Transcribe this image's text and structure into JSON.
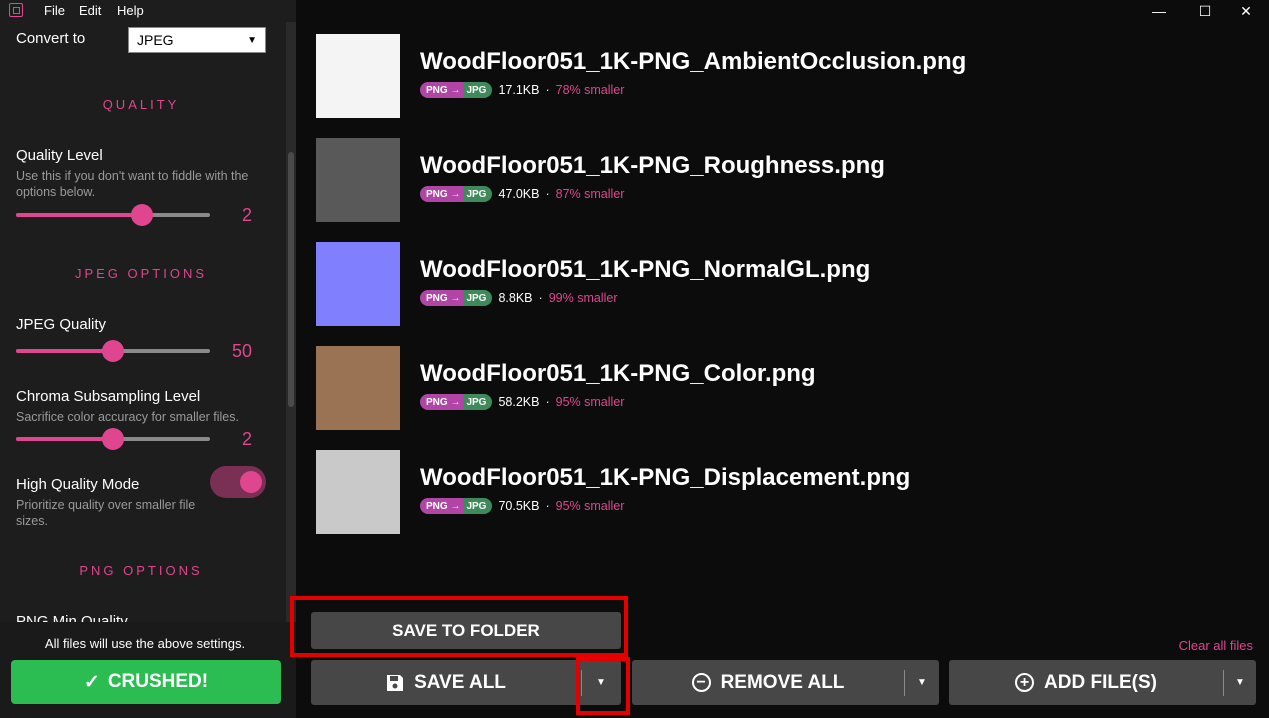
{
  "menu": {
    "file": "File",
    "edit": "Edit",
    "help": "Help"
  },
  "window_controls": {
    "minimize": "—",
    "maximize": "☐",
    "close": "✕"
  },
  "sidebar": {
    "convert_to_label": "Convert to",
    "convert_to_value": "JPEG",
    "quality_section": "QUALITY",
    "quality_level_label": "Quality Level",
    "quality_level_desc": "Use this if you don't want to fiddle with the options below.",
    "quality_level_value": "2",
    "quality_level_fraction": 0.65,
    "jpeg_section": "JPEG OPTIONS",
    "jpeg_quality_label": "JPEG Quality",
    "jpeg_quality_value": "50",
    "jpeg_quality_fraction": 0.5,
    "chroma_label": "Chroma Subsampling Level",
    "chroma_desc": "Sacrifice color accuracy for smaller files.",
    "chroma_value": "2",
    "chroma_fraction": 0.5,
    "hq_label": "High Quality Mode",
    "hq_desc": "Prioritize quality over smaller file sizes.",
    "hq_enabled": true,
    "png_section": "PNG OPTIONS",
    "png_min_quality_label": "PNG Min Quality",
    "footer_note": "All files will use the above settings.",
    "crushed_label": "CRUSHED!"
  },
  "files": [
    {
      "name": "WoodFloor051_1K-PNG_AmbientOcclusion.png",
      "from": "PNG",
      "to": "JPG",
      "size": "17.1KB",
      "saving": "78% smaller",
      "thumb_color": "#f4f4f4"
    },
    {
      "name": "WoodFloor051_1K-PNG_Roughness.png",
      "from": "PNG",
      "to": "JPG",
      "size": "47.0KB",
      "saving": "87% smaller",
      "thumb_color": "#595959"
    },
    {
      "name": "WoodFloor051_1K-PNG_NormalGL.png",
      "from": "PNG",
      "to": "JPG",
      "size": "8.8KB",
      "saving": "99% smaller",
      "thumb_color": "#8080ff"
    },
    {
      "name": "WoodFloor051_1K-PNG_Color.png",
      "from": "PNG",
      "to": "JPG",
      "size": "58.2KB",
      "saving": "95% smaller",
      "thumb_color": "#9a7354"
    },
    {
      "name": "WoodFloor051_1K-PNG_Displacement.png",
      "from": "PNG",
      "to": "JPG",
      "size": "70.5KB",
      "saving": "95% smaller",
      "thumb_color": "#c9c9c9"
    }
  ],
  "actions": {
    "save_to_folder": "SAVE TO FOLDER",
    "clear_all": "Clear all files",
    "save_all": "SAVE ALL",
    "remove_all": "REMOVE ALL",
    "add_files": "ADD FILE(S)"
  },
  "colors": {
    "accent": "#e0458f",
    "success": "#2bbd52",
    "highlight": "#e50000"
  }
}
